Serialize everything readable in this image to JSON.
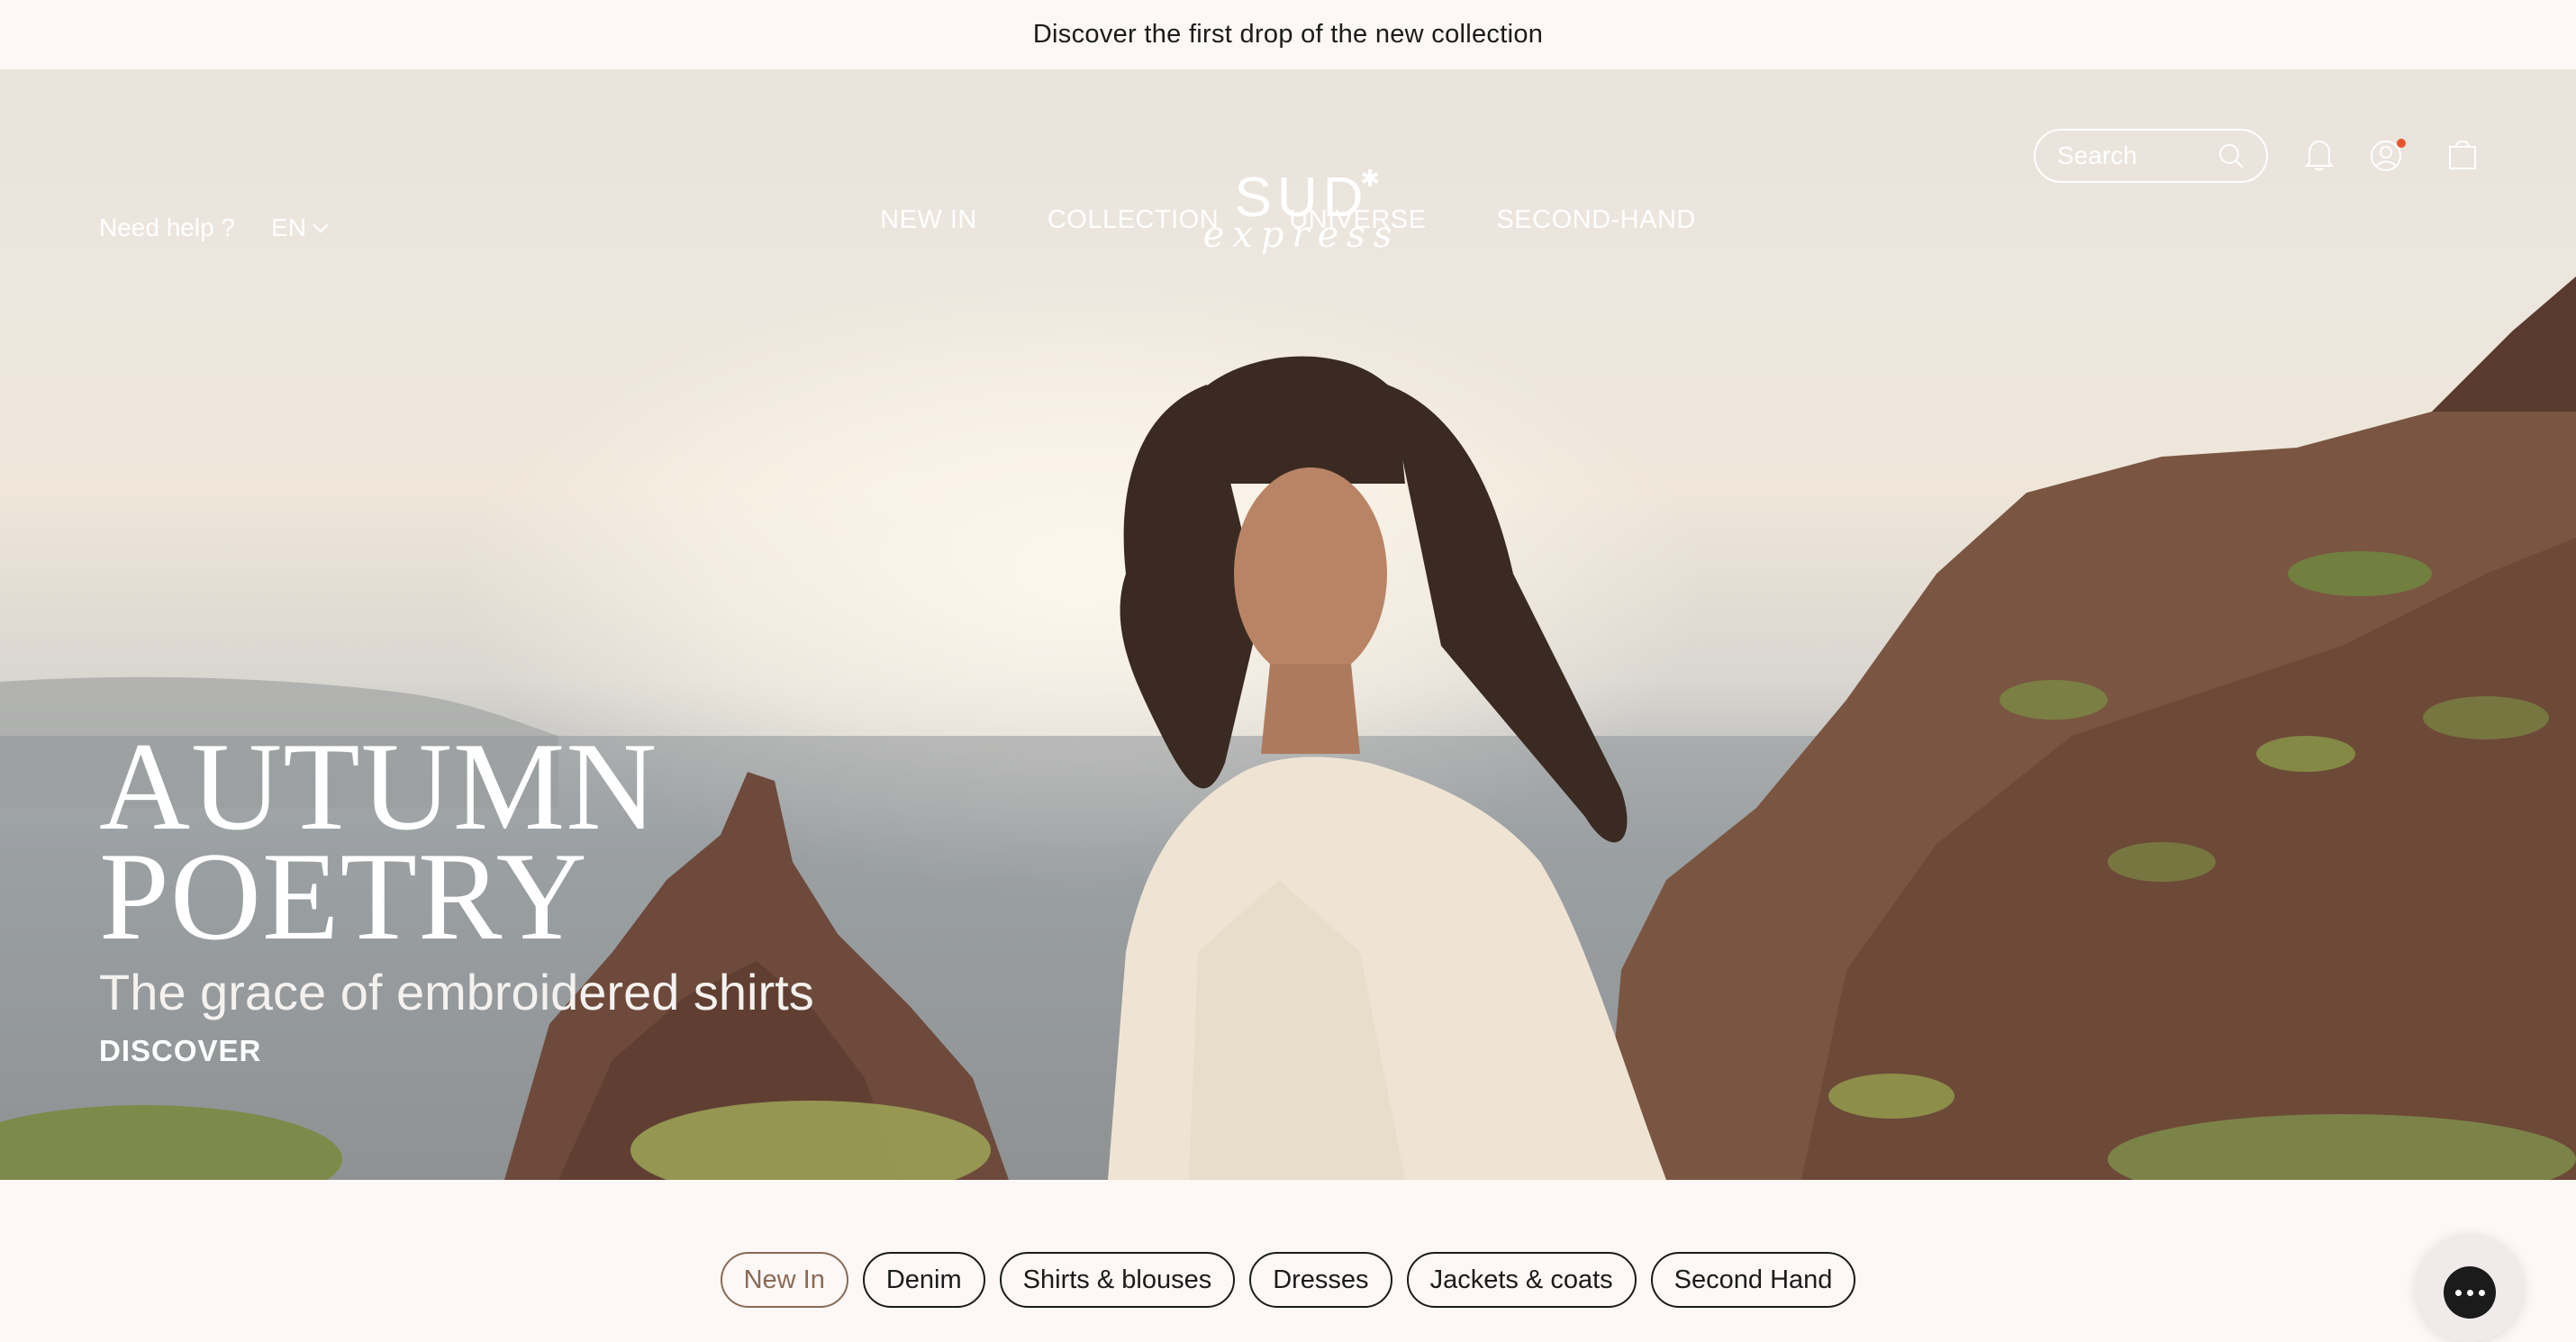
{
  "announcement": "Discover the first drop of the new collection",
  "header": {
    "help_label": "Need help ?",
    "language": "EN",
    "logo_text": "SUD",
    "logo_script": "express",
    "search_placeholder": "Search"
  },
  "nav": {
    "items": [
      {
        "label": "NEW IN"
      },
      {
        "label": "COLLECTION"
      },
      {
        "label": "UNIVERSE"
      },
      {
        "label": "SECOND-HAND"
      }
    ]
  },
  "icons": {
    "search": "search-icon",
    "notifications": "bell-icon",
    "account": "user-icon",
    "cart": "shopping-bag-icon",
    "language": "chevron-down-icon",
    "chat": "chat-icon"
  },
  "hero": {
    "title_line1": "AUTUMN",
    "title_line2": "POETRY",
    "subtitle": "The grace of embroidered shirts",
    "cta": "DISCOVER"
  },
  "categories": {
    "items": [
      {
        "label": "New In",
        "active": true
      },
      {
        "label": "Denim",
        "active": false
      },
      {
        "label": "Shirts & blouses",
        "active": false
      },
      {
        "label": "Dresses",
        "active": false
      },
      {
        "label": "Jackets & coats",
        "active": false
      },
      {
        "label": "Second Hand",
        "active": false
      }
    ]
  },
  "colors": {
    "background": "#fdf7f6",
    "text": "#1b1b1b",
    "active_chip": "#8a6a55",
    "notification_dot": "#e8552d"
  }
}
